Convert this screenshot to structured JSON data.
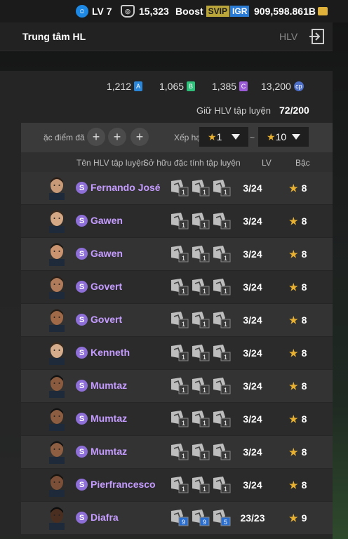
{
  "topbar": {
    "level": "LV 7",
    "level_icon": "level-smiley-icon",
    "shield_value": "15,323",
    "boost": "Boost",
    "svip": "SVIP",
    "igr": "IGR",
    "bp": "909,598.861B"
  },
  "header": {
    "title": "Trung tâm HL",
    "hlv": "HLV",
    "exit_icon": "exit-icon"
  },
  "resources": [
    {
      "value": "1,212",
      "letter": "A",
      "color": "#2a86d8"
    },
    {
      "value": "1,065",
      "letter": "B",
      "color": "#2fbf7a"
    },
    {
      "value": "1,385",
      "letter": "C",
      "color": "#9b5ad8"
    },
    {
      "value": "13,200",
      "letter": "cp",
      "color": "#4e6fc7"
    }
  ],
  "hold": {
    "label": "Giữ HLV tập luyện",
    "value": "72/200"
  },
  "filter": {
    "traits_label": "ặc điểm đã",
    "rank_label": "Xếp hạ",
    "min_grade": "1",
    "tilde": "~",
    "max_grade": "10"
  },
  "columns": {
    "name": "Tên HLV tập luyện",
    "traits": "Sở hữu đặc tính tập luyện",
    "lv": "LV",
    "grade": "Bậc"
  },
  "rows": [
    {
      "name": "Fernando José",
      "lv": "3/24",
      "grade": "8",
      "traits": [
        "1",
        "1",
        "1"
      ]
    },
    {
      "name": "Gawen",
      "lv": "3/24",
      "grade": "8",
      "traits": [
        "1",
        "1",
        "1"
      ]
    },
    {
      "name": "Gawen",
      "lv": "3/24",
      "grade": "8",
      "traits": [
        "1",
        "1",
        "1"
      ]
    },
    {
      "name": "Govert",
      "lv": "3/24",
      "grade": "8",
      "traits": [
        "1",
        "1",
        "1"
      ]
    },
    {
      "name": "Govert",
      "lv": "3/24",
      "grade": "8",
      "traits": [
        "1",
        "1",
        "1"
      ]
    },
    {
      "name": "Kenneth",
      "lv": "3/24",
      "grade": "8",
      "traits": [
        "1",
        "1",
        "1"
      ]
    },
    {
      "name": "Mumtaz",
      "lv": "3/24",
      "grade": "8",
      "traits": [
        "1",
        "1",
        "1"
      ]
    },
    {
      "name": "Mumtaz",
      "lv": "3/24",
      "grade": "8",
      "traits": [
        "1",
        "1",
        "1"
      ]
    },
    {
      "name": "Mumtaz",
      "lv": "3/24",
      "grade": "8",
      "traits": [
        "1",
        "1",
        "1"
      ]
    },
    {
      "name": "Pierfrancesco",
      "lv": "3/24",
      "grade": "8",
      "traits": [
        "1",
        "1",
        "1"
      ]
    },
    {
      "name": "Diafra",
      "lv": "23/23",
      "grade": "9",
      "traits": [
        "9",
        "9",
        "5"
      ]
    }
  ]
}
